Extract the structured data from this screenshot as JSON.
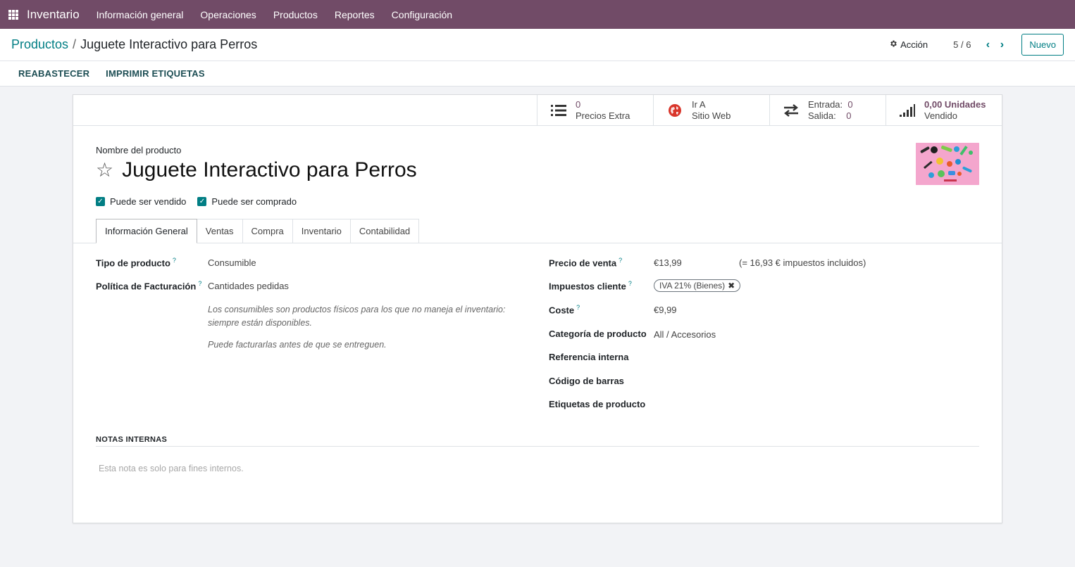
{
  "navbar": {
    "app_name": "Inventario",
    "menu": [
      "Información general",
      "Operaciones",
      "Productos",
      "Reportes",
      "Configuración"
    ]
  },
  "breadcrumb": {
    "parent": "Productos",
    "separator": "/",
    "current": "Juguete Interactivo para Perros"
  },
  "control": {
    "action_label": "Acción",
    "pager": "5 / 6",
    "new_label": "Nuevo"
  },
  "actions": {
    "replenish": "REABASTECER",
    "print_labels": "IMPRIMIR ETIQUETAS"
  },
  "smart_buttons": {
    "extra_prices": {
      "value": "0",
      "label": "Precios Extra",
      "icon": "list-icon"
    },
    "website": {
      "line1": "Ir A",
      "line2": "Sitio Web",
      "icon": "globe-icon"
    },
    "moves": {
      "in_label": "Entrada:",
      "in_value": "0",
      "out_label": "Salida:",
      "out_value": "0",
      "icon": "arrows-exchange-icon"
    },
    "sold": {
      "value": "0,00 Unidades",
      "label": "Vendido",
      "icon": "signal-bars-icon"
    }
  },
  "product": {
    "name_label": "Nombre del producto",
    "name": "Juguete Interactivo para Perros",
    "can_be_sold": "Puede ser vendido",
    "can_be_purchased": "Puede ser comprado"
  },
  "tabs": [
    "Información General",
    "Ventas",
    "Compra",
    "Inventario",
    "Contabilidad"
  ],
  "general": {
    "type_label": "Tipo de producto",
    "type_value": "Consumible",
    "invoice_label": "Política de Facturación",
    "invoice_value": "Cantidades pedidas",
    "help1_line1": "Los consumibles son productos físicos para los que no maneja el inventario:",
    "help1_line2": "siempre están disponibles.",
    "help2": "Puede facturarlas antes de que se entreguen.",
    "price_label": "Precio de venta",
    "price_value": "€13,99",
    "price_taxed": "(= 16,93 € impuestos incluidos)",
    "taxes_label": "Impuestos cliente",
    "tax_tag": "IVA 21% (Bienes)",
    "cost_label": "Coste",
    "cost_value": "€9,99",
    "category_label": "Categoría de producto",
    "category_value": "All / Accesorios",
    "ref_label": "Referencia interna",
    "barcode_label": "Código de barras",
    "tags_label": "Etiquetas de producto",
    "qmark": "?"
  },
  "notes": {
    "label": "NOTAS INTERNAS",
    "placeholder": "Esta nota es solo para fines internos."
  },
  "colors": {
    "brand": "#714b67",
    "accent": "#017e84"
  }
}
